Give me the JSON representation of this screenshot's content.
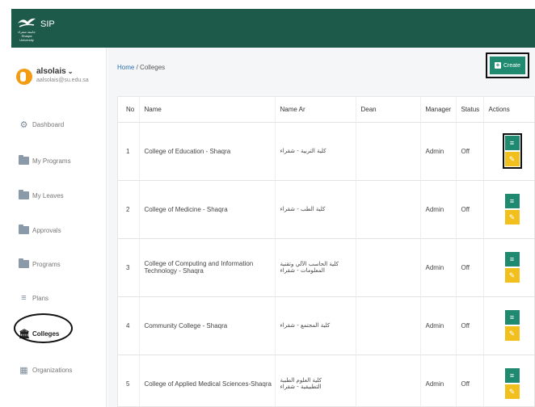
{
  "app": {
    "brand": "SIP",
    "logo_text_ar": "جامعة شقراء",
    "logo_text_en": "Shaqra University"
  },
  "user": {
    "name": "alsolais",
    "email": "aalsolais@su.edu.sa"
  },
  "nav": [
    {
      "label": "Dashboard",
      "icon": "dashboard-icon"
    },
    {
      "label": "My Programs",
      "icon": "folder-icon"
    },
    {
      "label": "My Leaves",
      "icon": "folder-icon"
    },
    {
      "label": "Approvals",
      "icon": "folder-icon"
    },
    {
      "label": "Programs",
      "icon": "folder-icon"
    },
    {
      "label": "Plans",
      "icon": "list-icon"
    },
    {
      "label": "Colleges",
      "icon": "institution-icon"
    },
    {
      "label": "Organizations",
      "icon": "building-icon"
    }
  ],
  "breadcrumb": {
    "home": "Home",
    "sep": "/",
    "current": "Colleges"
  },
  "create_label": "Create",
  "table": {
    "headers": {
      "no": "No",
      "name": "Name",
      "name_ar": "Name Ar",
      "dean": "Dean",
      "manager": "Manager",
      "status": "Status",
      "actions": "Actions"
    },
    "rows": [
      {
        "no": "1",
        "name": "College of Education - Shaqra",
        "name_ar": "كلية التربية - شقراء",
        "dean": "",
        "manager": "Admin",
        "status": "Off"
      },
      {
        "no": "2",
        "name": "College of Medicine - Shaqra",
        "name_ar": "كلية الطب - شقراء",
        "dean": "",
        "manager": "Admin",
        "status": "Off"
      },
      {
        "no": "3",
        "name": "College of Computing and Information Technology - Shaqra",
        "name_ar": "كلية الحاسب الآلي وتقنية المعلومات - شقراء",
        "dean": "",
        "manager": "Admin",
        "status": "Off"
      },
      {
        "no": "4",
        "name": "Community College - Shaqra",
        "name_ar": "كلية المجتمع - شقراء",
        "dean": "",
        "manager": "Admin",
        "status": "Off"
      },
      {
        "no": "5",
        "name": "College of Applied Medical Sciences-Shaqra",
        "name_ar": "كلية العلوم الطبية التطبيقية - شقراء",
        "dean": "",
        "manager": "Admin",
        "status": "Off"
      }
    ]
  },
  "colors": {
    "topbar": "#1e5a4a",
    "primary": "#1f8a70",
    "warning": "#f2c01e",
    "avatar": "#f39c12"
  }
}
